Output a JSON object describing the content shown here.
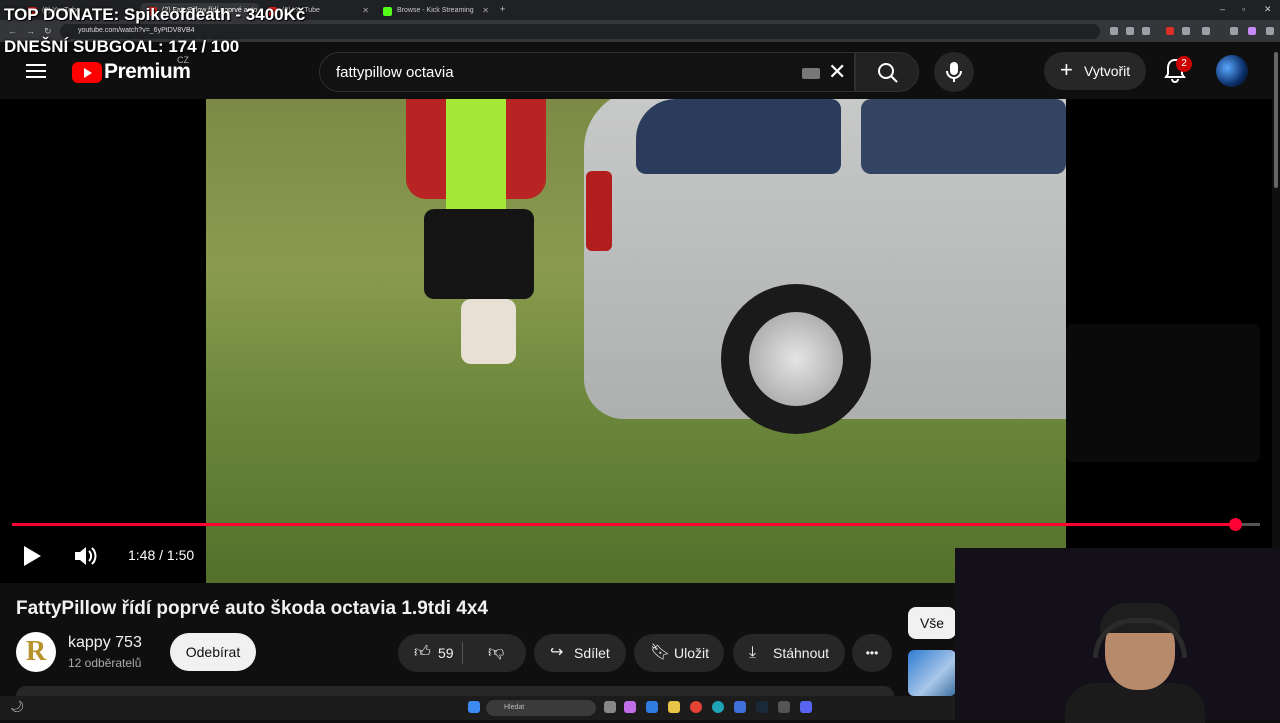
{
  "overlay": {
    "top_donate": "TOP DONATE: Spikeofdeath - 3400Kč",
    "subgoal": "DNEŠNÍ SUBGOAL: 174 / 100"
  },
  "browser": {
    "tabs": [
      {
        "title": "(2) YouTube"
      },
      {
        "title": "(2) FattyPillow řídí poprvé auto"
      },
      {
        "title": "(2) YouTube"
      },
      {
        "title": "Browse - Kick Streaming"
      }
    ],
    "url": "youtube.com/watch?v=_6yPtDV8VB4"
  },
  "youtube": {
    "logo_text": "Premium",
    "country": "CZ",
    "search_value": "fattypillow octavia",
    "create_label": "Vytvořit",
    "notif_count": "2"
  },
  "player": {
    "time": "1:48 / 1:50",
    "progress": 0.98
  },
  "video": {
    "title": "FattyPillow řídí poprvé auto škoda octavia 1.9tdi 4x4",
    "channel_name": "kappy 753",
    "channel_initial": "R",
    "subscribers": "12 odběratelů",
    "unsubscribe_label": "Odebírat",
    "likes": "59",
    "share_label": "Sdílet",
    "save_label": "Uložit",
    "download_label": "Stáhnout",
    "more_label": "•••"
  },
  "sidebar": {
    "chip_all": "Vše"
  },
  "taskbar": {
    "search_placeholder": "Hledat"
  },
  "colors": {
    "accent": "#ff0033",
    "background": "#0f0f0f",
    "chip": "#272727"
  }
}
